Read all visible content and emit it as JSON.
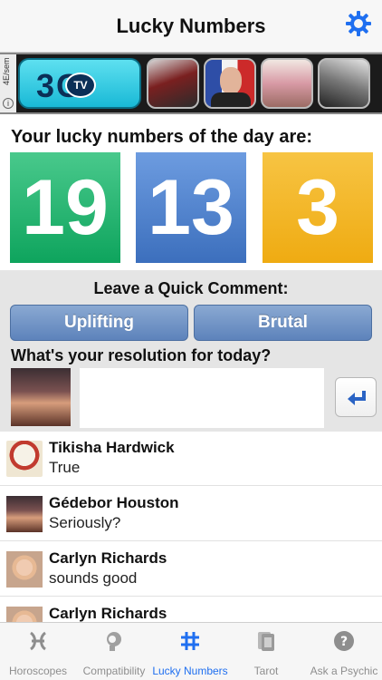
{
  "header": {
    "title": "Lucky Numbers",
    "settings_icon": "gear-icon"
  },
  "ad": {
    "side_label": "4E/sem",
    "logo_text": "3G",
    "logo_badge": "TV"
  },
  "lucky": {
    "title": "Your lucky numbers of the day are:",
    "numbers": [
      "19",
      "13",
      "3"
    ],
    "colors": [
      "#1bb36d",
      "#4a7fcb",
      "#f2b325"
    ]
  },
  "comment": {
    "title": "Leave a Quick Comment:",
    "buttons": [
      "Uplifting",
      "Brutal"
    ],
    "question": "What's your resolution for today?",
    "input_value": "",
    "input_placeholder": ""
  },
  "feed": [
    {
      "name": "Tikisha Hardwick",
      "message": "True"
    },
    {
      "name": "Gédebor Houston",
      "message": "Seriously?"
    },
    {
      "name": "Carlyn Richards",
      "message": "sounds good"
    },
    {
      "name": "Carlyn Richards",
      "message": ""
    }
  ],
  "tabs": [
    {
      "label": "Horoscopes",
      "icon": "pisces-icon"
    },
    {
      "label": "Compatibility",
      "icon": "heads-icon"
    },
    {
      "label": "Lucky Numbers",
      "icon": "hash-icon",
      "active": true
    },
    {
      "label": "Tarot",
      "icon": "cards-icon"
    },
    {
      "label": "Ask a Psychic",
      "icon": "question-icon"
    }
  ],
  "accent_color": "#1f6ff0"
}
